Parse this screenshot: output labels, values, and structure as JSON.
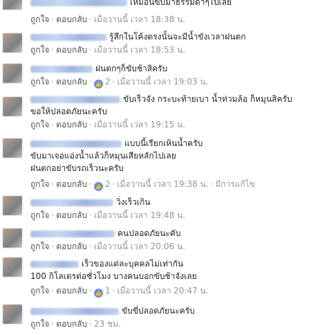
{
  "actions": {
    "like": "ถูกใจ",
    "reply": "ตอบกลับ",
    "separator": "·"
  },
  "comments": [
    {
      "lines": [
        "เหมือนขับมาธรรมดาๆไปเลย"
      ],
      "time": "เมื่อวานนี้ เวลา 18:38 น."
    },
    {
      "lines": [
        "รู้สึกในโค้งตรงนั้นจะมีน้ำขังเวลาฝนตก"
      ],
      "time": "เมื่อวานนี้ เวลา 18:53 น."
    },
    {
      "lines": [
        "ฝนตกๆก็ขับช้าสิครับ"
      ],
      "likes": "2",
      "time": "เมื่อวานนี้ เวลา 19:03 น."
    },
    {
      "lines": [
        "ขับเร็วจัง กระบะท้ายเบา น้ำท่วมล้อ ก็หมุนสิครับ",
        "ขอให้ปลอดภัยนะครับ"
      ],
      "time": "เมื่อวานนี้ เวลา 19:15 น."
    },
    {
      "lines": [
        "แบบนี้เรียกเหินน้ำครับ",
        "ขับมาเจอแอ่งน้ำแล้วก็หมุนเสียหลักไปเลย",
        "ฝนตกอย่าขับรถเร็วนะครับ"
      ],
      "likes": "2",
      "time": "เมื่อวานนี้ เวลา 19:38 น.",
      "edited": "มีการแก้ไข"
    },
    {
      "lines": [
        "วิ่งเร็วเกิน"
      ],
      "time": "เมื่อวานนี้ เวลา 19:48 น."
    },
    {
      "lines": [
        "คนปลอดภัยนะคับ"
      ],
      "time": "เมื่อวานนี้ เวลา 20:06 น."
    },
    {
      "lines": [
        "เร็วของแต่ละบุคคลไม่เท่ากัน",
        "100 กิโลเตรต่อชั่วโมง บางคนบอกขับช้าจังเลย"
      ],
      "likes": "1",
      "time": "เมื่อวานนี้ เวลา 20:47 น."
    },
    {
      "lines": [
        "ขับขี่ปลอดภัยนะครับ"
      ],
      "time": "23 ชม."
    }
  ]
}
